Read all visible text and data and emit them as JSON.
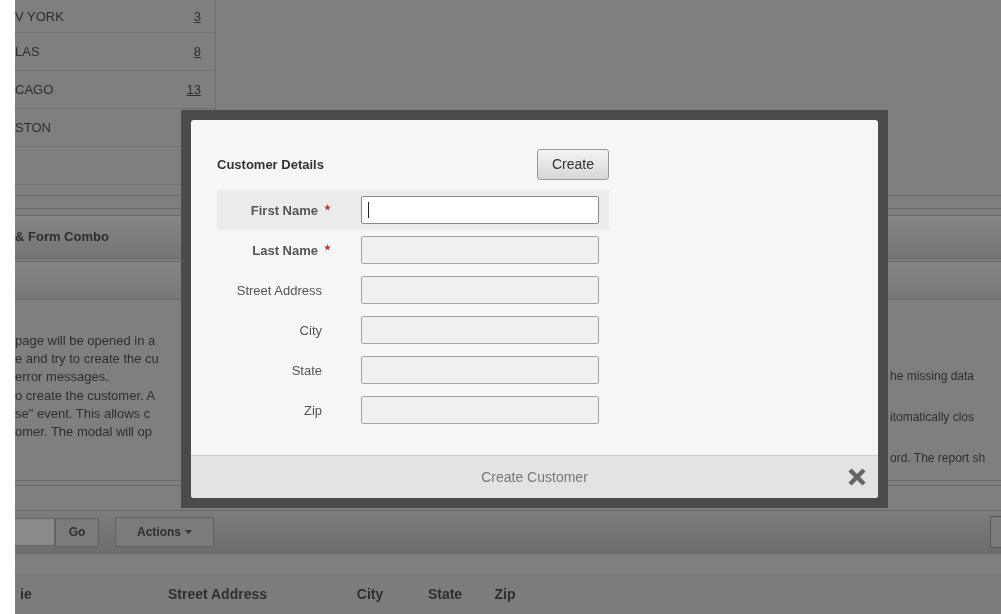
{
  "report_rows": [
    {
      "city": "V YORK",
      "count": "3"
    },
    {
      "city": "LAS",
      "count": "8"
    },
    {
      "city": "CAGO",
      "count": "13"
    },
    {
      "city": "STON"
    }
  ],
  "region_title": "& Form Combo",
  "instructions_left": [
    "page will be opened in a",
    "e and try to create the cu",
    "error messages.",
    "o create the customer. A",
    "se\" event. This allows c",
    "omer. The modal will op"
  ],
  "instructions_right": [
    "he missing data",
    "itomatically clos",
    "ord. The report sh"
  ],
  "toolbar": {
    "go": "Go",
    "actions": "Actions"
  },
  "table_columns": [
    "ie",
    "Street Address",
    "City",
    "State",
    "Zip"
  ],
  "modal": {
    "title": "Customer Details",
    "create_button": "Create",
    "fields": [
      {
        "label": "First Name",
        "required": true,
        "focused": true
      },
      {
        "label": "Last Name",
        "required": true,
        "focused": false
      },
      {
        "label": "Street Address",
        "required": false,
        "focused": false
      },
      {
        "label": "City",
        "required": false,
        "focused": false
      },
      {
        "label": "State",
        "required": false,
        "focused": false
      },
      {
        "label": "Zip",
        "required": false,
        "focused": false
      }
    ],
    "footer_title": "Create Customer"
  }
}
